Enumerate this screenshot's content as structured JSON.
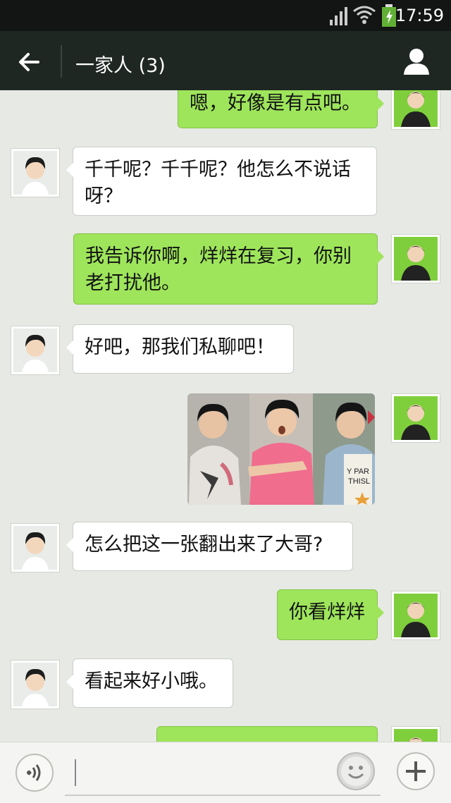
{
  "status_bar": {
    "time": "17:59"
  },
  "header": {
    "title": "一家人 (3)"
  },
  "messages": [
    {
      "side": "right",
      "text": "嗯，好像是有点吧。"
    },
    {
      "side": "left",
      "text": "千千呢？千千呢？他怎么不说话呀？"
    },
    {
      "side": "right",
      "text": "我告诉你啊，烊烊在复习，你别老打扰他。"
    },
    {
      "side": "left",
      "text": "好吧，那我们私聊吧！"
    },
    {
      "side": "right",
      "type": "image"
    },
    {
      "side": "left",
      "text": "怎么把这一张翻出来了大哥?"
    },
    {
      "side": "right",
      "text": "你看烊烊"
    },
    {
      "side": "left",
      "text": "看起来好小哦。"
    },
    {
      "side": "right",
      "text": ""
    }
  ],
  "photo": {
    "shirt_text_1": "Y PAR",
    "shirt_text_2": "THISL"
  },
  "input": {
    "placeholder": ""
  },
  "icons": {
    "back": "back-arrow-icon",
    "profile": "person-icon",
    "voice": "voice-icon",
    "emoji": "emoji-icon",
    "add": "plus-icon"
  },
  "colors": {
    "sent_bubble": "#9ee55b",
    "received_bubble": "#ffffff",
    "nav_bg": "#1f2723"
  }
}
